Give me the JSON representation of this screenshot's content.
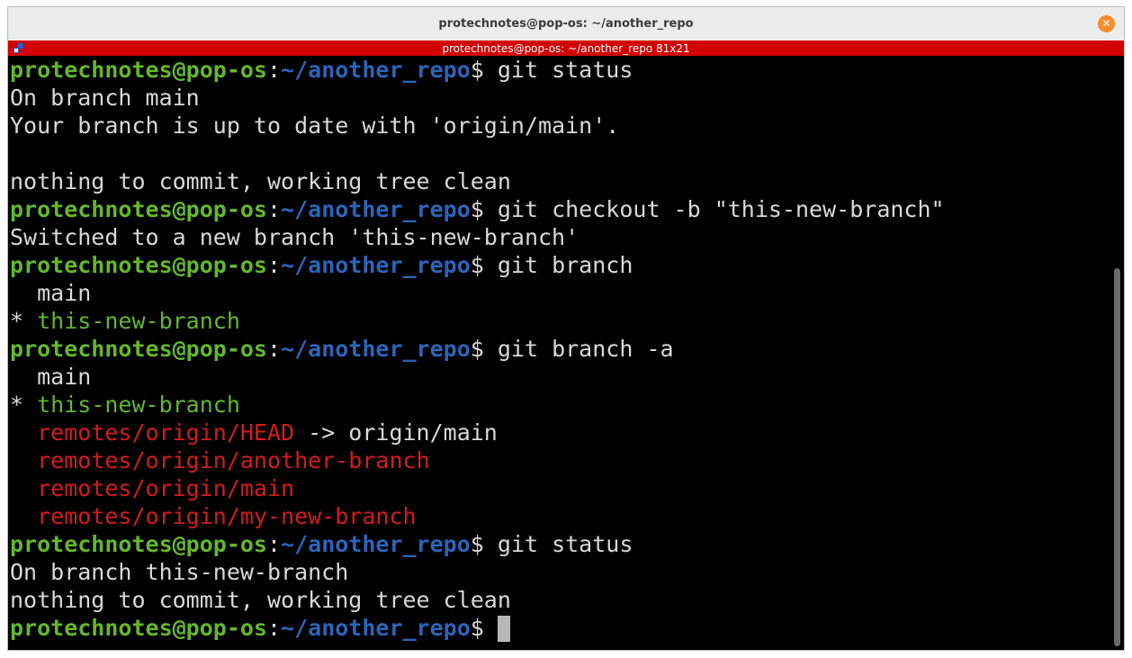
{
  "window": {
    "title": "protechnotes@pop-os: ~/another_repo",
    "close_glyph": "✕"
  },
  "tab": {
    "title": "protechnotes@pop-os: ~/another_repo 81x21"
  },
  "prompt": {
    "user_host": "protechnotes@pop-os",
    "separator": ":",
    "path": "~/another_repo",
    "symbol": "$"
  },
  "terminal": {
    "commands": [
      " git status",
      " git checkout -b \"this-new-branch\"",
      " git branch",
      " git branch -a",
      " git status",
      " "
    ],
    "output": {
      "status1_branch": "On branch main",
      "status1_uptodate": "Your branch is up to date with 'origin/main'.",
      "status1_clean": "nothing to commit, working tree clean",
      "checkout_result": "Switched to a new branch 'this-new-branch'",
      "branch_main": "  main",
      "branch_star": "* ",
      "branch_current": "this-new-branch",
      "branch_indent": "  ",
      "remote_head": "remotes/origin/HEAD",
      "remote_head_target": " -> origin/main",
      "remote_another": "remotes/origin/another-branch",
      "remote_main": "remotes/origin/main",
      "remote_my_new": "remotes/origin/my-new-branch",
      "status2_branch": "On branch this-new-branch",
      "status2_clean": "nothing to commit, working tree clean"
    }
  },
  "colors": {
    "prompt_user": "#64b72b",
    "prompt_path": "#2c64b9",
    "remote_branch": "#d41c1c",
    "tab_bar": "#d20000",
    "close_button": "#fb8c2e"
  }
}
